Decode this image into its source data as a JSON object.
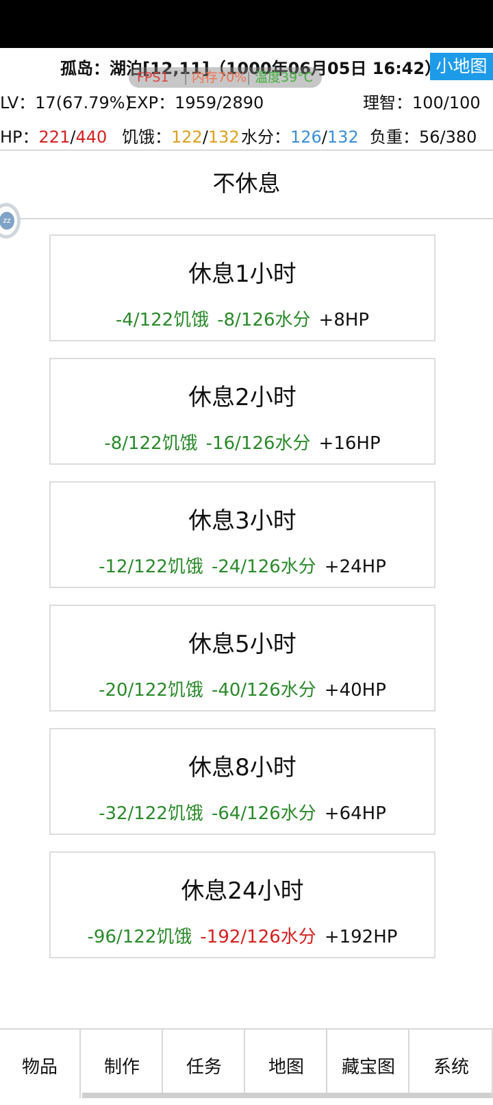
{
  "header": {
    "location": "孤岛：湖泊[12,11]（1000年06月05日 16:42）",
    "minimap_label": "小地图",
    "lv": "LV：17(67.79%)",
    "exp": "EXP：1959/2890",
    "sanity": "理智：100/100",
    "hp_label": "HP：",
    "hp_current": "221",
    "hp_sep": "/",
    "hp_max": "440",
    "hunger_label": "饥饿：",
    "hunger_current": "122",
    "hunger_sep": "/",
    "hunger_max": "132",
    "water_label": "水分：",
    "water_current": "126",
    "water_sep": "/",
    "water_max": "132",
    "weight": "负重：56/380"
  },
  "overlay": {
    "fps": "FPS1",
    "memory": "内存70%",
    "temperature": "温度39°C"
  },
  "no_rest_label": "不休息",
  "rest_options": [
    {
      "title": "休息1小时",
      "hunger": "-4/122饥饿",
      "water": "-8/126水分",
      "hp": "+8HP"
    },
    {
      "title": "休息2小时",
      "hunger": "-8/122饥饿",
      "water": "-16/126水分",
      "hp": "+16HP"
    },
    {
      "title": "休息3小时",
      "hunger": "-12/122饥饿",
      "water": "-24/126水分",
      "hp": "+24HP"
    },
    {
      "title": "休息5小时",
      "hunger": "-20/122饥饿",
      "water": "-40/126水分",
      "hp": "+40HP"
    },
    {
      "title": "休息8小时",
      "hunger": "-32/122饥饿",
      "water": "-64/126水分",
      "hp": "+64HP"
    },
    {
      "title": "休息24小时",
      "hunger": "-96/122饥饿",
      "water": "-192/126水分",
      "hp": "+192HP"
    }
  ],
  "nav": [
    "物品",
    "制作",
    "任务",
    "地图",
    "藏宝图",
    "系统"
  ],
  "colors": {
    "accent": "#1e9be8",
    "positive": "#2a8a2a",
    "negative": "#d62020",
    "hunger": "#e0a020",
    "water": "#3a8fd8"
  }
}
